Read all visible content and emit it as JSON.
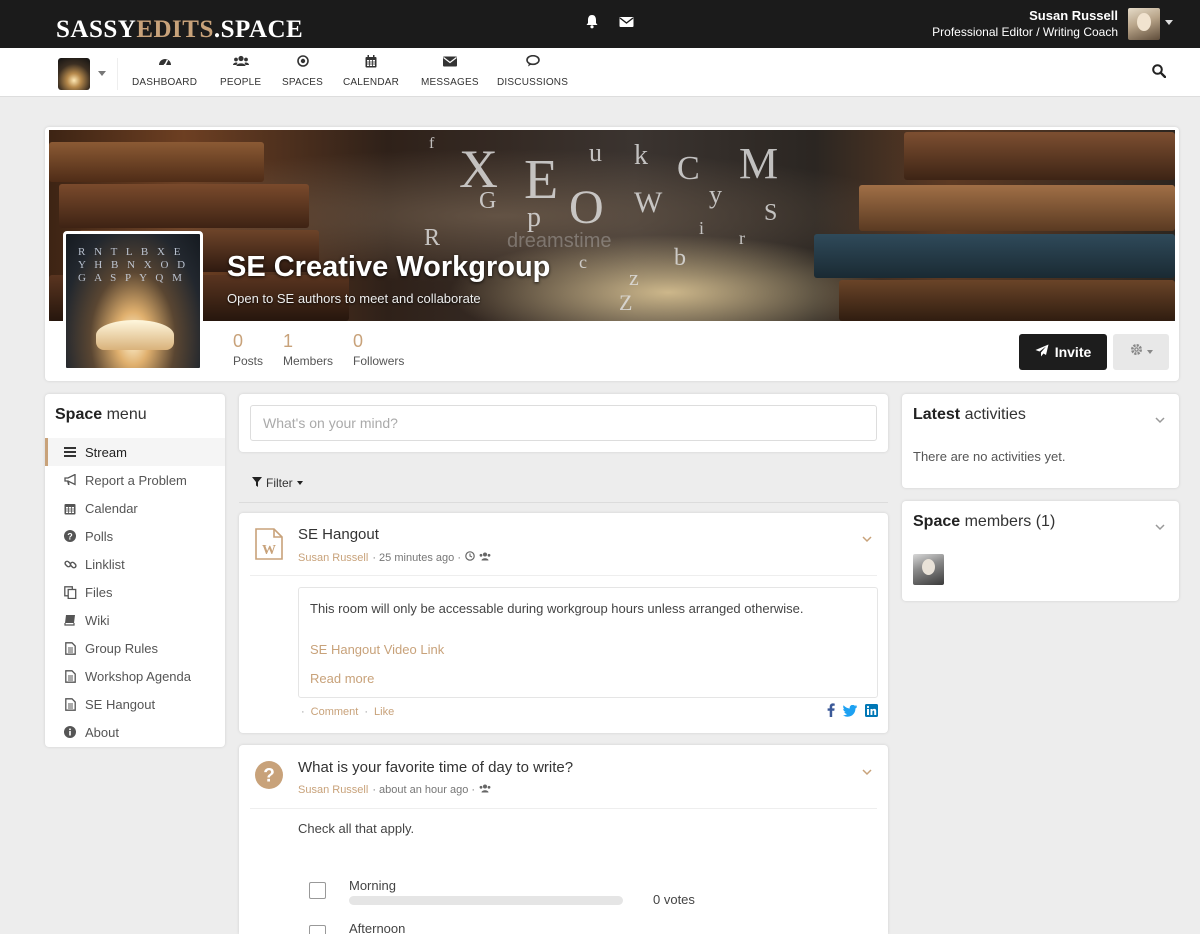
{
  "topbar": {
    "logo_part1": "SASSY",
    "logo_part2": "EDITS",
    "logo_part3": ".SPACE",
    "user_name": "Susan Russell",
    "user_title": "Professional Editor / Writing Coach",
    "icons": [
      "bell-icon",
      "envelope-icon"
    ]
  },
  "nav": {
    "items": [
      {
        "label": "DASHBOARD",
        "icon": "dashboard-icon"
      },
      {
        "label": "PEOPLE",
        "icon": "users-icon"
      },
      {
        "label": "SPACES",
        "icon": "dot-circle-icon"
      },
      {
        "label": "CALENDAR",
        "icon": "calendar-icon"
      },
      {
        "label": "MESSAGES",
        "icon": "envelope-icon"
      },
      {
        "label": "DISCUSSIONS",
        "icon": "chat-icon"
      }
    ]
  },
  "space": {
    "title": "SE Creative Workgroup",
    "subtitle": "Open to SE authors to meet and collaborate",
    "watermark": "dreamstime",
    "stats": [
      {
        "value": "0",
        "label": "Posts"
      },
      {
        "value": "1",
        "label": "Members"
      },
      {
        "value": "0",
        "label": "Followers"
      }
    ],
    "invite_label": "Invite"
  },
  "space_menu": {
    "title_bold": "Space",
    "title_rest": " menu",
    "items": [
      {
        "label": "Stream",
        "icon": "bars-icon",
        "active": true
      },
      {
        "label": "Report a Problem",
        "icon": "bullhorn-icon"
      },
      {
        "label": "Calendar",
        "icon": "calendar-icon"
      },
      {
        "label": "Polls",
        "icon": "question-circle-icon"
      },
      {
        "label": "Linklist",
        "icon": "link-icon"
      },
      {
        "label": "Files",
        "icon": "files-icon"
      },
      {
        "label": "Wiki",
        "icon": "book-icon"
      },
      {
        "label": "Group Rules",
        "icon": "page-icon"
      },
      {
        "label": "Workshop Agenda",
        "icon": "page-icon"
      },
      {
        "label": "SE Hangout",
        "icon": "page-icon"
      },
      {
        "label": "About",
        "icon": "info-circle-icon"
      }
    ]
  },
  "stream": {
    "placeholder": "What's on your mind?",
    "filter_label": "Filter"
  },
  "post": {
    "title": "SE Hangout",
    "author": "Susan Russell",
    "time": "· 25 minutes ago ·",
    "body": "This room will only be accessable during workgroup hours unless arranged otherwise.",
    "link_text": "SE Hangout Video Link",
    "read_more": "Read more",
    "comment": "Comment",
    "like": "Like",
    "dot": "·"
  },
  "poll": {
    "title": "What is your favorite time of day to write?",
    "author": "Susan Russell",
    "time": "· about an hour ago ·",
    "description": "Check all that apply.",
    "options": [
      {
        "label": "Morning",
        "votes": "0 votes",
        "fraction": 0
      },
      {
        "label": "Afternoon",
        "votes": "",
        "fraction": 0
      }
    ]
  },
  "sidebar": {
    "activities_bold": "Latest",
    "activities_rest": " activities",
    "activities_empty": "There are no activities yet.",
    "members_bold": "Space",
    "members_rest": " members (1)"
  },
  "colors": {
    "accent": "#c8a27a",
    "topbar": "#1b1b1b",
    "background": "#ededed",
    "invite": "#1d1d1d"
  }
}
